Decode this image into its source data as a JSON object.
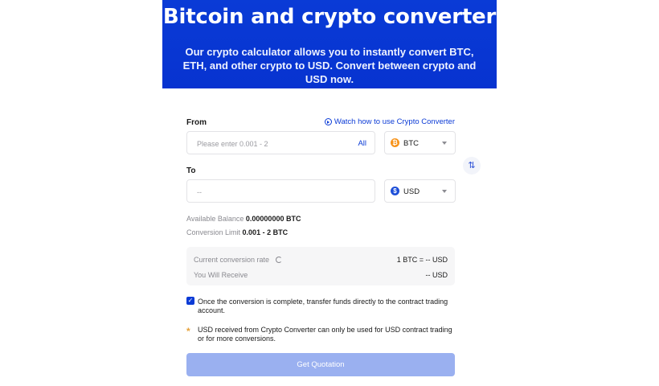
{
  "hero": {
    "title": "Bitcoin and crypto converter",
    "subtitle": "Our crypto calculator allows you to instantly convert BTC, ETH, and other crypto to USD. Convert between crypto and USD now."
  },
  "from": {
    "label": "From",
    "placeholder": "Please enter 0.001 - 2",
    "all_label": "All",
    "currency": "BTC",
    "coin_glyph": "₿",
    "coin_color": "#f7931a"
  },
  "watch_link": "Watch how to use Crypto Converter",
  "to": {
    "label": "To",
    "value": "--",
    "currency": "USD",
    "coin_glyph": "$",
    "coin_color": "#1e4fd8"
  },
  "swap_icon": "swap-vertical-icon",
  "balance": {
    "label": "Available Balance",
    "value": "0.00000000 BTC"
  },
  "limit": {
    "label": "Conversion Limit",
    "value": "0.001 - 2 BTC"
  },
  "rate": {
    "label": "Current conversion rate",
    "value": "1 BTC = -- USD",
    "receive_label": "You Will Receive",
    "receive_value": "-- USD"
  },
  "transfer_note": "Once the conversion is complete, transfer funds directly to the contract trading account.",
  "usd_note": "USD received from Crypto Converter can only be used for USD contract trading or for more conversions.",
  "cta_label": "Get Quotation",
  "colors": {
    "brand": "#0733d0",
    "accent": "#0b3bd6",
    "cta_disabled": "#9ab0f0"
  }
}
